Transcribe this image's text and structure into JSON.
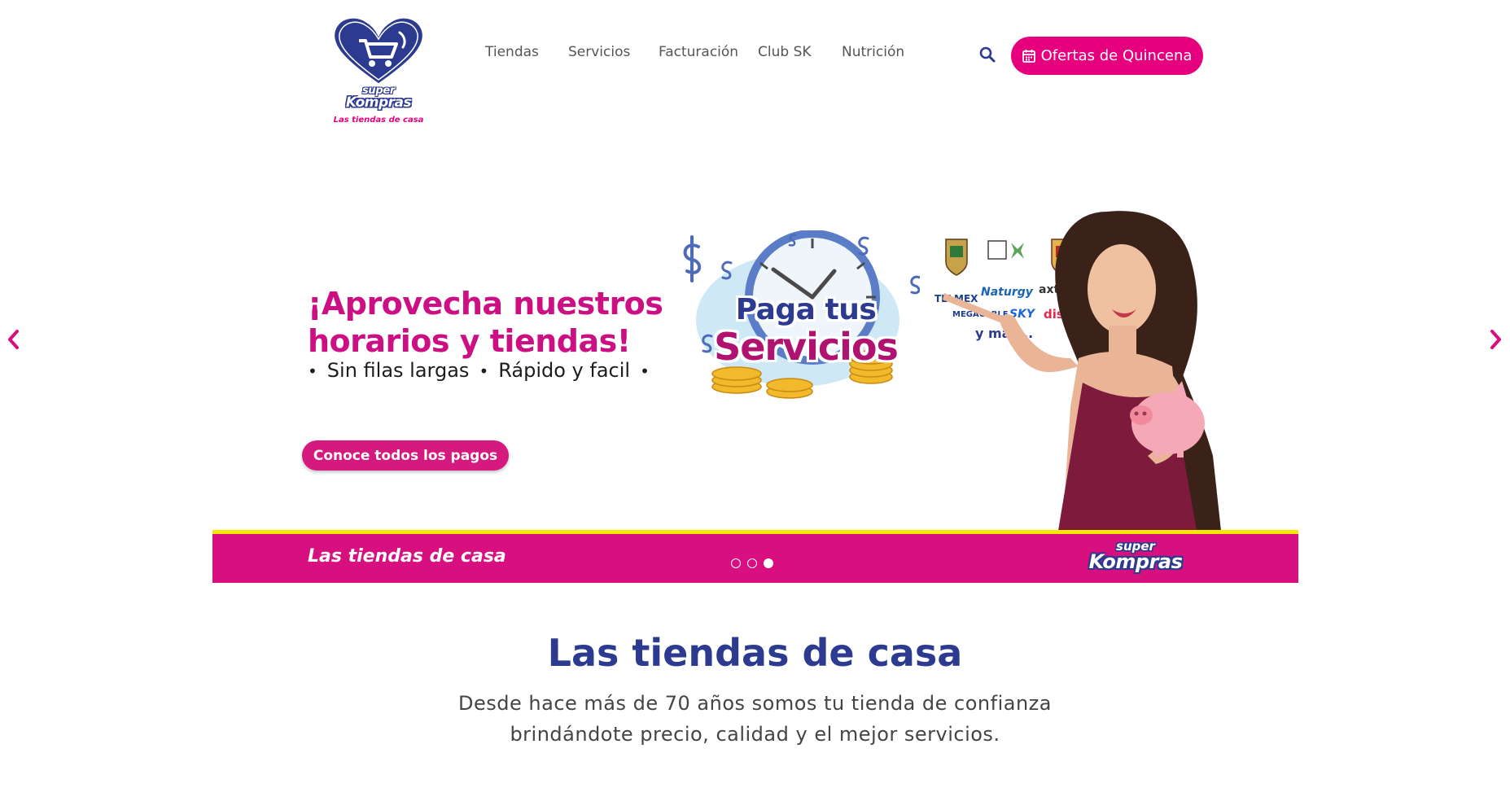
{
  "header": {
    "logo": {
      "super": "super",
      "kompras": "Kompras",
      "tagline": "Las tiendas de casa"
    },
    "nav": [
      {
        "label": "Tiendas"
      },
      {
        "label": "Servicios"
      },
      {
        "label": "Facturación"
      },
      {
        "label": "Club SK"
      },
      {
        "label": "Nutrición"
      }
    ],
    "search_icon": "search-icon",
    "cta_label": "Ofertas de Quincena",
    "cta_icon": "calendar-icon"
  },
  "hero": {
    "title_line1": "¡Aprovecha nuestros",
    "title_line2": "horarios y tiendas!",
    "bullet1": "Sin filas largas",
    "bullet2": "Rápido y facil",
    "button_label": "Conoce todos los pagos",
    "badge_line1": "Paga tus",
    "badge_line2": "Servicios",
    "brands": [
      "TELMEX",
      "Naturgy",
      "axtel",
      "MEGACABLE",
      "SKY",
      "dish"
    ],
    "more": "y más...",
    "prev_icon": "chevron-left-icon",
    "next_icon": "chevron-right-icon"
  },
  "band": {
    "tagline": "Las tiendas de casa",
    "logo_super": "super",
    "logo_kompras": "Kompras",
    "slides_total": 3,
    "active_slide": 3
  },
  "section": {
    "title": "Las tiendas de casa",
    "subtitle_line1": "Desde hace más de 70 años somos tu tienda de confianza",
    "subtitle_line2": "brindándote precio, calidad y el mejor servicios."
  },
  "colors": {
    "brand_pink": "#e6007e",
    "brand_navy": "#2c3a8f",
    "band_yellow": "#f6e600"
  }
}
